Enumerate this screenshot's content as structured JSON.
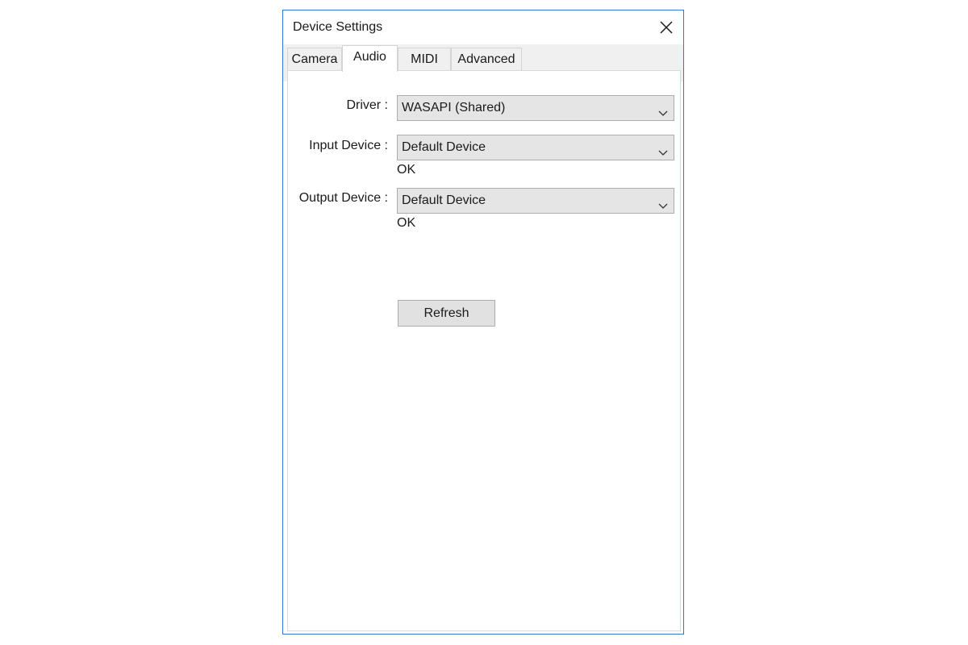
{
  "window": {
    "title": "Device Settings"
  },
  "tabs": [
    {
      "label": "Camera",
      "active": false
    },
    {
      "label": "Audio",
      "active": true
    },
    {
      "label": "MIDI",
      "active": false
    },
    {
      "label": "Advanced",
      "active": false
    }
  ],
  "audio": {
    "driver": {
      "label": "Driver :",
      "value": "WASAPI (Shared)"
    },
    "input_device": {
      "label": "Input Device :",
      "value": "Default Device",
      "status": "OK"
    },
    "output_device": {
      "label": "Output Device :",
      "value": "Default Device",
      "status": "OK"
    },
    "refresh_label": "Refresh"
  },
  "icons": {
    "close": "close-icon",
    "dropdown": "chevron-down-icon"
  },
  "colors": {
    "window_border": "#2b79d0",
    "tabstrip_bg": "#f0f0f0",
    "control_bg": "#e5e5e5",
    "control_border": "#adadad"
  }
}
